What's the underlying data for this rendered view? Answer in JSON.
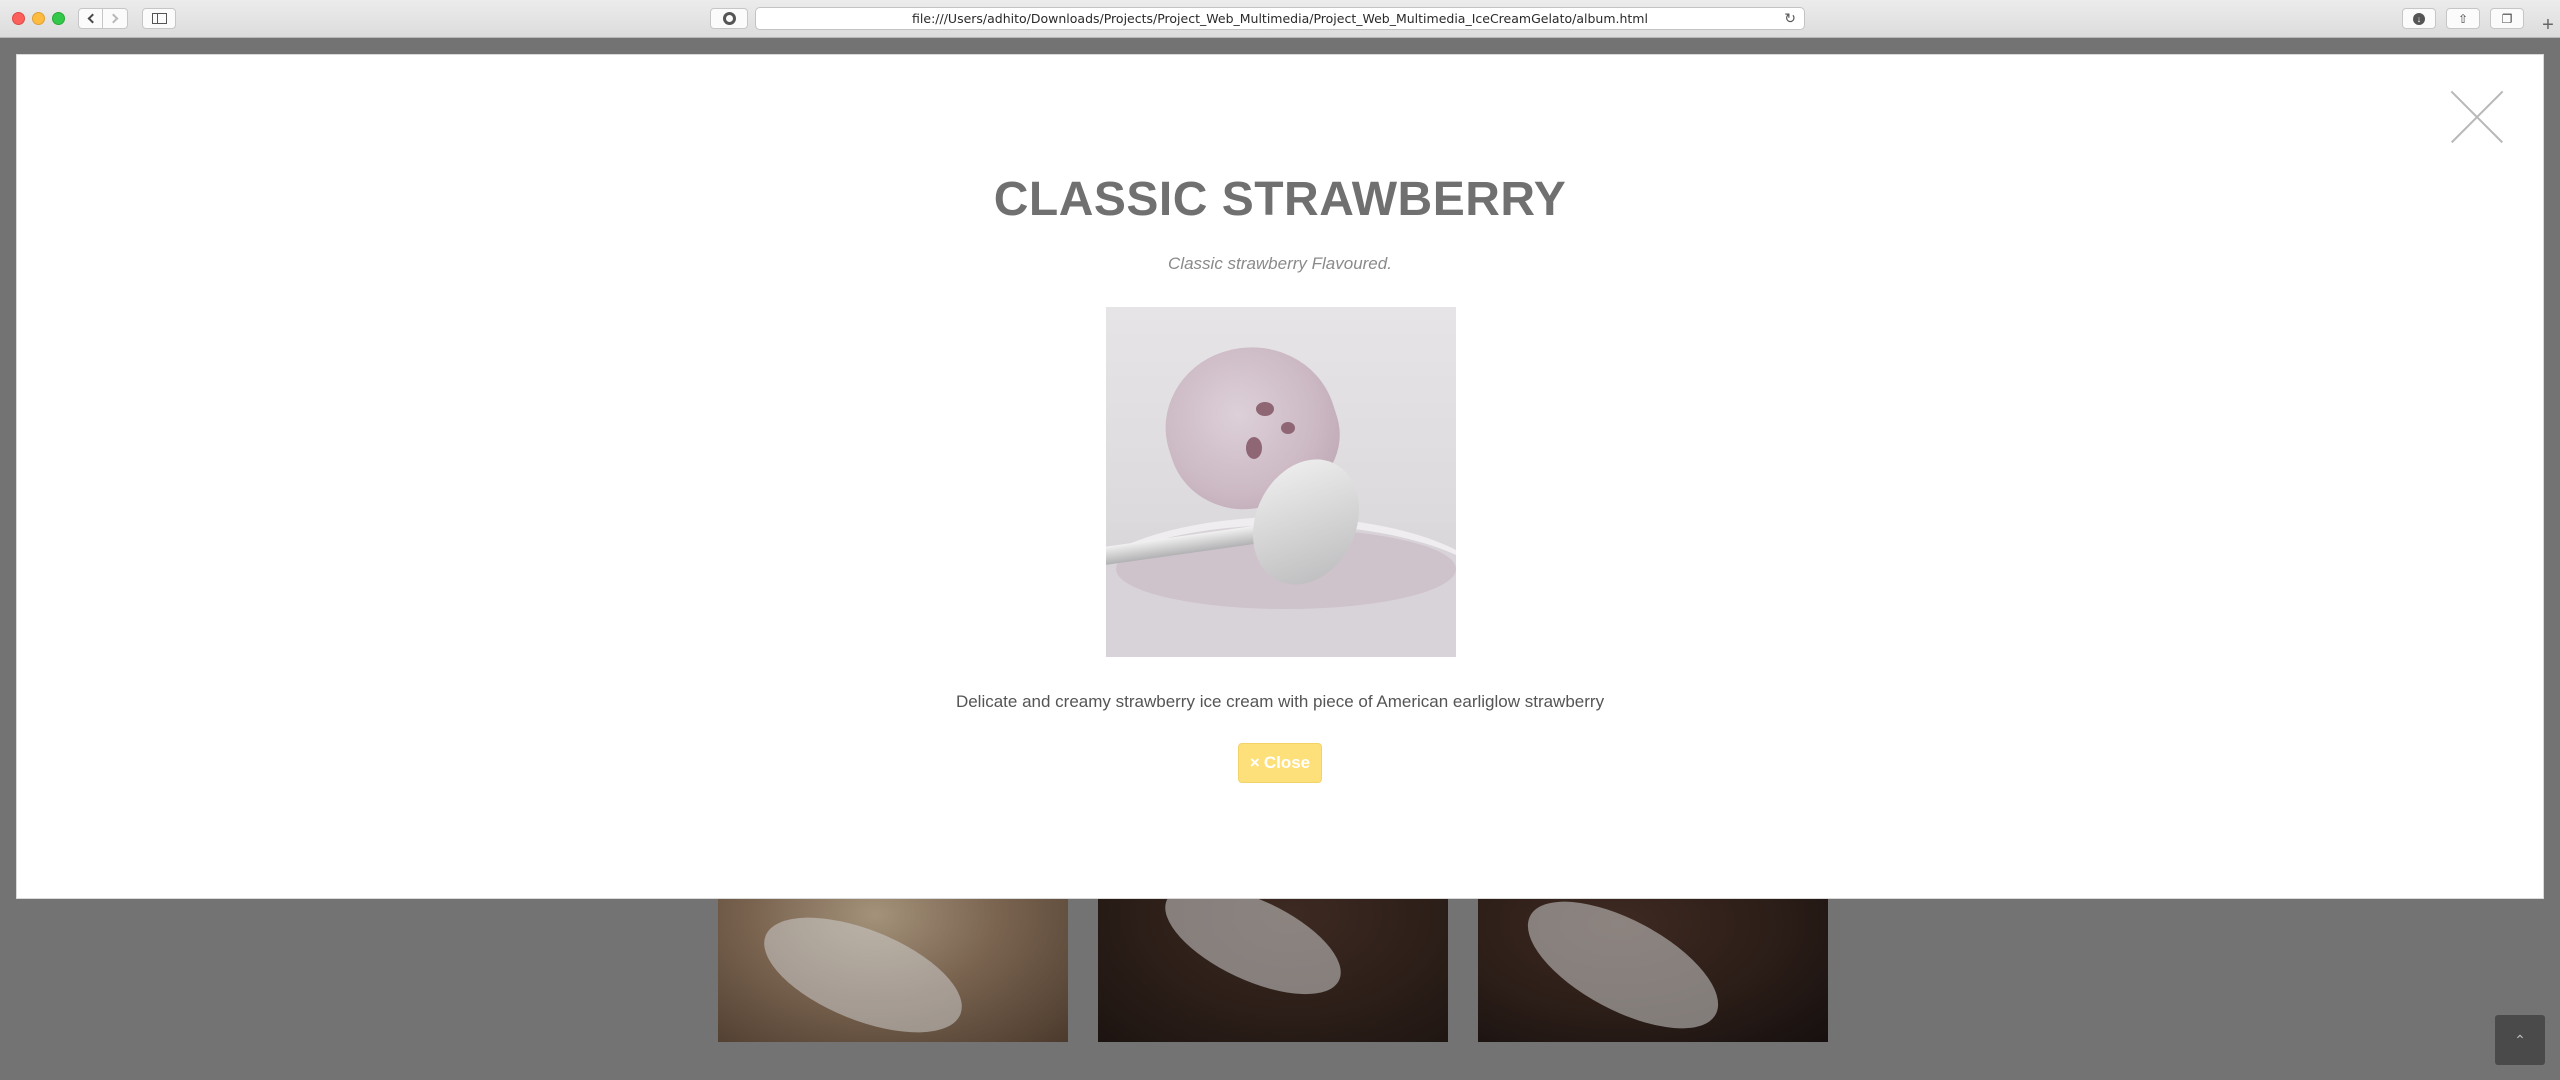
{
  "browser": {
    "url": "file:///Users/adhito/Downloads/Projects/Project_Web_Multimedia/Project_Web_Multimedia_IceCreamGelato/album.html",
    "newtab_glyph": "+"
  },
  "modal": {
    "title": "CLASSIC STRAWBERRY",
    "subtitle": "Classic strawberry Flavoured.",
    "description": "Delicate and creamy strawberry ice cream with piece of American earliglow strawberry",
    "close_icon": "×",
    "close_label": "Close"
  },
  "page": {
    "back_to_top": "⌃"
  }
}
